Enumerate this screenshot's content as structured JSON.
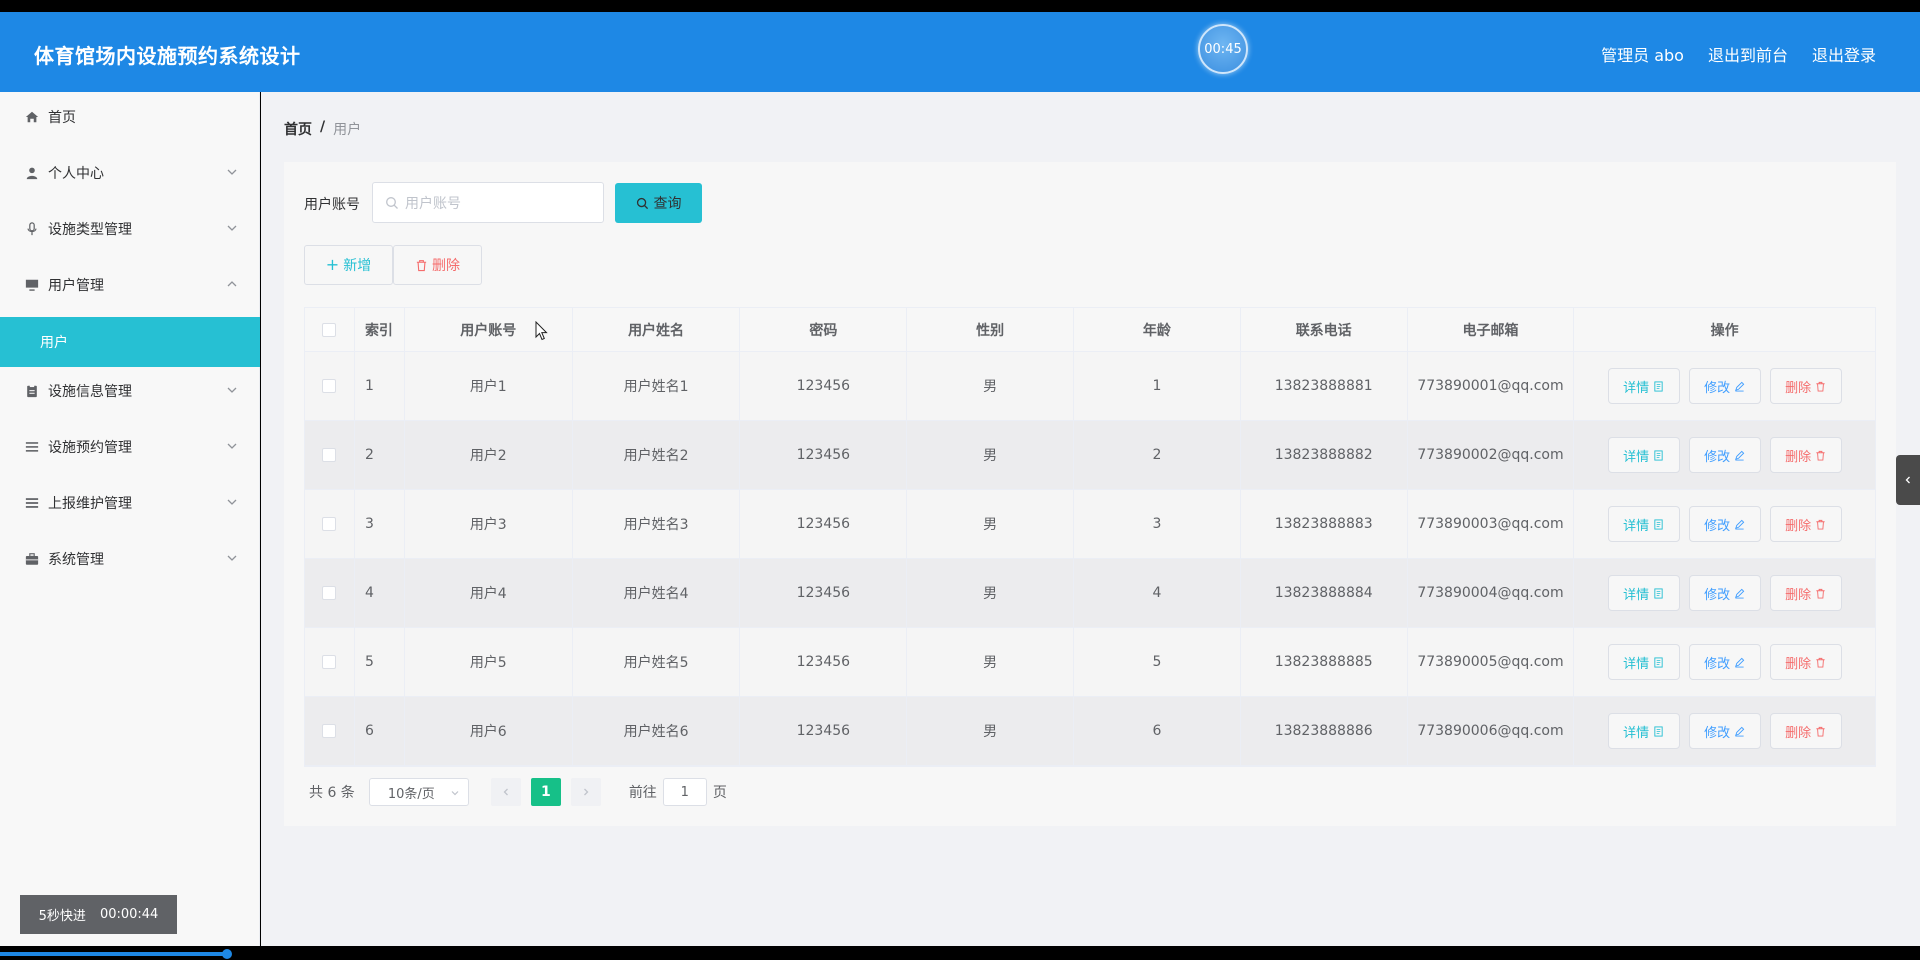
{
  "header": {
    "title": "体育馆场内设施预约系统设计",
    "timer": "00:45",
    "user": "管理员 abo",
    "to_front": "退出到前台",
    "logout": "退出登录"
  },
  "sidebar": {
    "items": [
      {
        "label": "首页",
        "icon": "home-icon"
      },
      {
        "label": "个人中心",
        "icon": "user-icon"
      },
      {
        "label": "设施类型管理",
        "icon": "microphone-icon"
      },
      {
        "label": "用户管理",
        "icon": "monitor-icon"
      },
      {
        "label": "设施信息管理",
        "icon": "clipboard-icon"
      },
      {
        "label": "设施预约管理",
        "icon": "list-icon"
      },
      {
        "label": "上报维护管理",
        "icon": "menu-icon"
      },
      {
        "label": "系统管理",
        "icon": "briefcase-icon"
      }
    ],
    "sub_active": "用户"
  },
  "fast_forward": {
    "label": "5秒快进",
    "time": "00:00:44"
  },
  "breadcrumb": {
    "home": "首页",
    "sep": "/",
    "current": "用户"
  },
  "search": {
    "label": "用户账号",
    "placeholder": "用户账号",
    "query_label": "查询"
  },
  "actions": {
    "add_label": "新增",
    "delete_label": "删除"
  },
  "table": {
    "headers": [
      "索引",
      "用户账号",
      "用户姓名",
      "密码",
      "性别",
      "年龄",
      "联系电话",
      "电子邮箱",
      "操作"
    ],
    "rows": [
      {
        "idx": "1",
        "account": "用户1",
        "name": "用户姓名1",
        "pwd": "123456",
        "sex": "男",
        "age": "1",
        "tel": "13823888881",
        "email": "773890001@qq.com"
      },
      {
        "idx": "2",
        "account": "用户2",
        "name": "用户姓名2",
        "pwd": "123456",
        "sex": "男",
        "age": "2",
        "tel": "13823888882",
        "email": "773890002@qq.com"
      },
      {
        "idx": "3",
        "account": "用户3",
        "name": "用户姓名3",
        "pwd": "123456",
        "sex": "男",
        "age": "3",
        "tel": "13823888883",
        "email": "773890003@qq.com"
      },
      {
        "idx": "4",
        "account": "用户4",
        "name": "用户姓名4",
        "pwd": "123456",
        "sex": "男",
        "age": "4",
        "tel": "13823888884",
        "email": "773890004@qq.com"
      },
      {
        "idx": "5",
        "account": "用户5",
        "name": "用户姓名5",
        "pwd": "123456",
        "sex": "男",
        "age": "5",
        "tel": "13823888885",
        "email": "773890005@qq.com"
      },
      {
        "idx": "6",
        "account": "用户6",
        "name": "用户姓名6",
        "pwd": "123456",
        "sex": "男",
        "age": "6",
        "tel": "13823888886",
        "email": "773890006@qq.com"
      }
    ],
    "op_detail": "详情",
    "op_edit": "修改",
    "op_delete": "删除"
  },
  "pagination": {
    "total": "共 6 条",
    "page_size": "10条/页",
    "current": "1",
    "goto_label": "前往",
    "goto_value": "1",
    "page_label": "页"
  },
  "colors": {
    "header_bg": "#1e88e5",
    "accent": "#26c0d3",
    "danger": "#f56c6c",
    "primary": "#409eff",
    "page_active": "#16c088"
  }
}
